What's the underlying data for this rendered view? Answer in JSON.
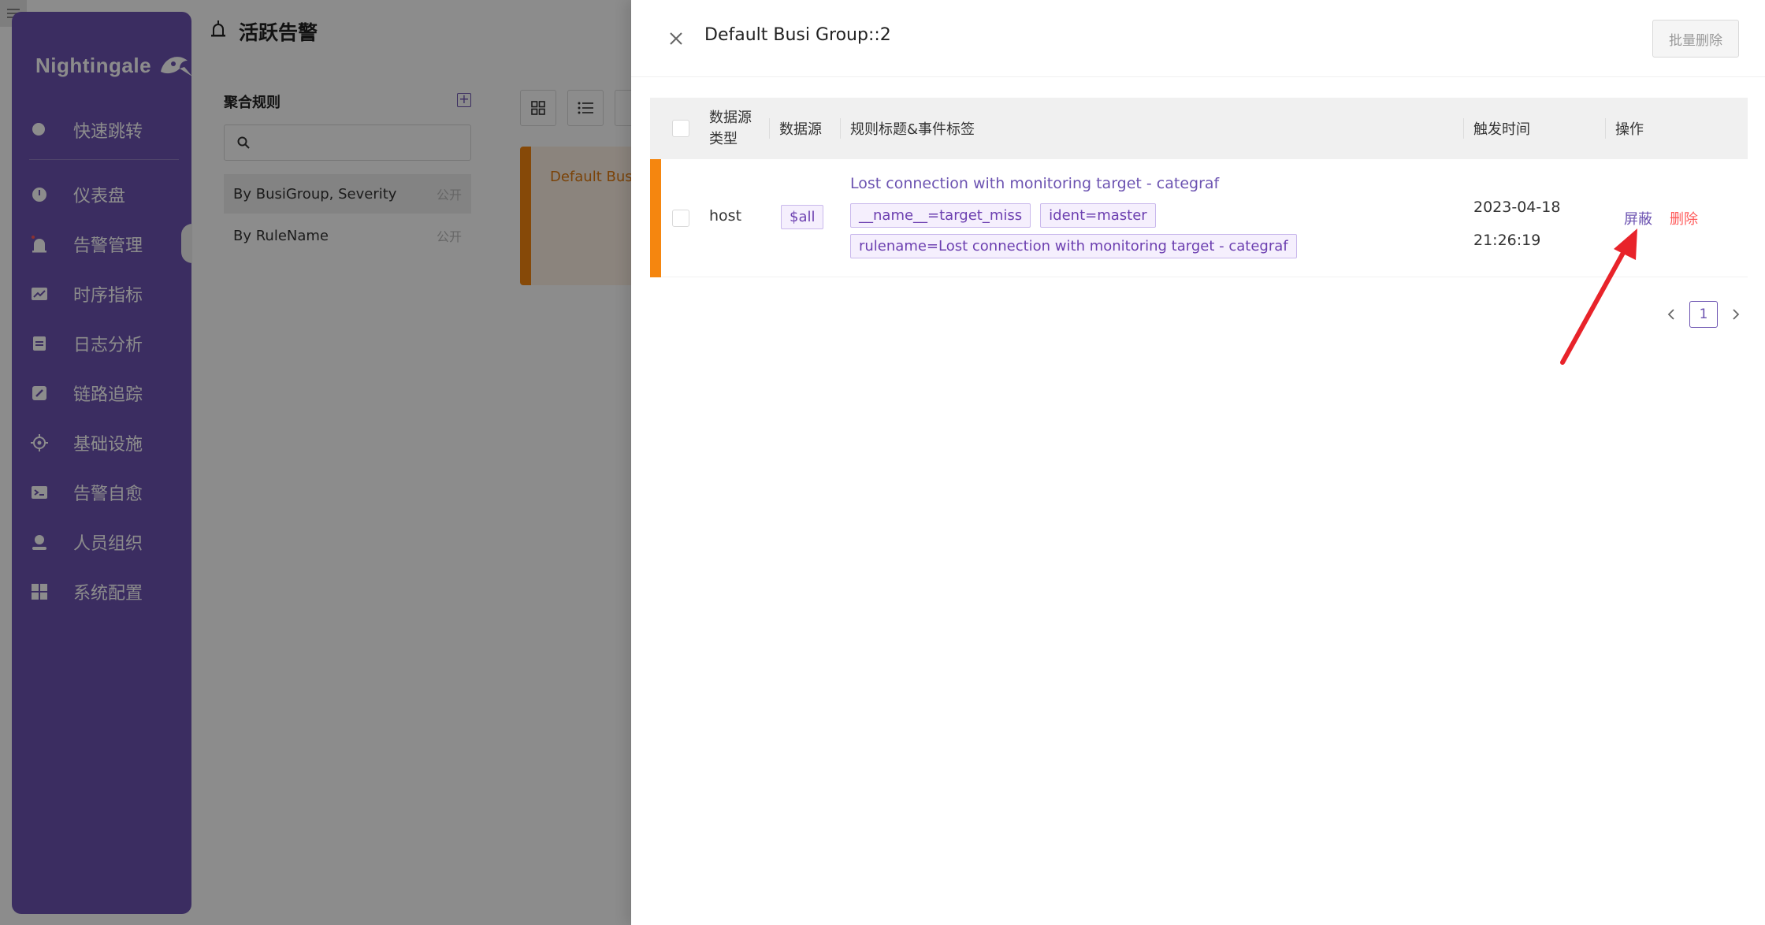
{
  "app": {
    "logo": "Nightingale",
    "page_title": "活跃告警",
    "nav": [
      {
        "label": "快速跳转",
        "icon": "search-icon"
      },
      {
        "label": "仪表盘",
        "icon": "dashboard-icon"
      },
      {
        "label": "告警管理",
        "icon": "alarm-icon",
        "active": true
      },
      {
        "label": "时序指标",
        "icon": "line-chart-icon"
      },
      {
        "label": "日志分析",
        "icon": "log-icon"
      },
      {
        "label": "链路追踪",
        "icon": "link-icon"
      },
      {
        "label": "基础设施",
        "icon": "target-icon"
      },
      {
        "label": "告警自愈",
        "icon": "terminal-icon"
      },
      {
        "label": "人员组织",
        "icon": "user-icon"
      },
      {
        "label": "系统配置",
        "icon": "settings-grid-icon"
      }
    ]
  },
  "agg": {
    "title": "聚合规则",
    "search_placeholder": "",
    "rules": [
      {
        "label": "By BusiGroup, Severity",
        "visibility": "公开"
      },
      {
        "label": "By RuleName",
        "visibility": "公开"
      }
    ]
  },
  "events": {
    "card_label": "Default Busi"
  },
  "drawer": {
    "title": "Default Busi Group::2",
    "batch_delete": "批量删除",
    "columns": {
      "ds_type": "数据源类型",
      "ds": "数据源",
      "rule": "规则标题&事件标签",
      "time": "触发时间",
      "ops": "操作"
    },
    "row": {
      "ds_type": "host",
      "ds": "$all",
      "rule_title": "Lost connection with monitoring target - categraf",
      "tags": [
        "__name__=target_miss",
        "ident=master",
        "rulename=Lost connection with monitoring target - categraf"
      ],
      "date": "2023-04-18",
      "time": "21:26:19",
      "shield": "屏蔽",
      "delete": "删除"
    },
    "pagination": {
      "current": "1"
    },
    "colors": {
      "accent": "#6c53b1",
      "severity": "#f5860f",
      "danger": "#ff5a5a",
      "annotation": "#e8232a"
    }
  }
}
